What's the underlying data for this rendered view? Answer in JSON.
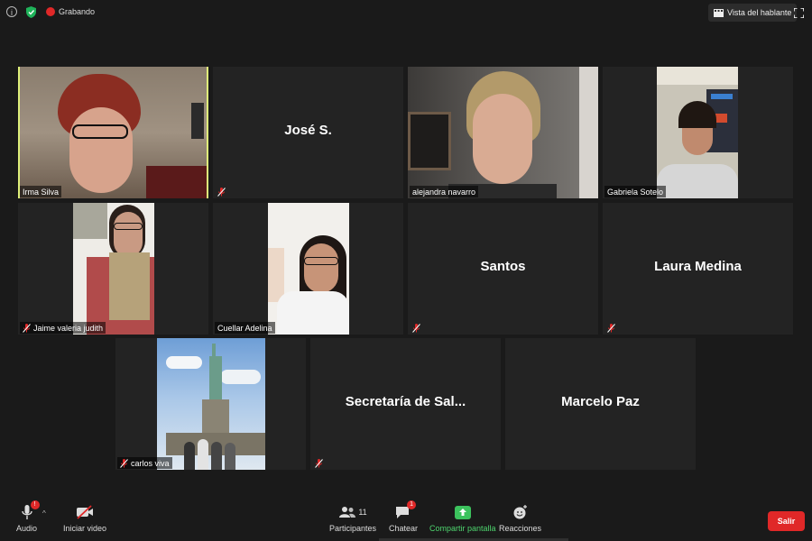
{
  "topbar": {
    "info_glyph": "i",
    "recording_label": "Grabando",
    "speaker_view_label": "Vista del hablante"
  },
  "tiles": [
    {
      "name": "Irma Silva",
      "display": "",
      "muted": false,
      "active": true
    },
    {
      "name": "",
      "display": "José S.",
      "muted": true,
      "active": false
    },
    {
      "name": "alejandra navarro",
      "display": "",
      "muted": false,
      "active": false
    },
    {
      "name": "Gabriela Sotelo",
      "display": "",
      "muted": false,
      "active": false
    },
    {
      "name": "Jaime valeria judith",
      "display": "",
      "muted": true,
      "active": false
    },
    {
      "name": "Cuellar Adelina",
      "display": "",
      "muted": false,
      "active": false
    },
    {
      "name": "",
      "display": "Santos",
      "muted": true,
      "active": false
    },
    {
      "name": "",
      "display": "Laura Medina",
      "muted": true,
      "active": false
    },
    {
      "name": "carlos viva",
      "display": "",
      "muted": true,
      "active": false
    },
    {
      "name": "",
      "display": "Secretaría de Sal...",
      "muted": true,
      "active": false
    },
    {
      "name": "",
      "display": "Marcelo Paz",
      "muted": false,
      "active": false
    }
  ],
  "toolbar": {
    "audio_label": "Audio",
    "audio_badge": "!",
    "video_label": "Iniciar video",
    "participants_label": "Participantes",
    "participants_count": "11",
    "chat_label": "Chatear",
    "chat_badge": "1",
    "share_label": "Compartir pantalla",
    "reactions_label": "Reacciones",
    "exit_label": "Salir"
  },
  "colors": {
    "active_border": "#dff07a",
    "recording": "#e02828",
    "share_green": "#4ed46e",
    "exit_red": "#e02828"
  }
}
